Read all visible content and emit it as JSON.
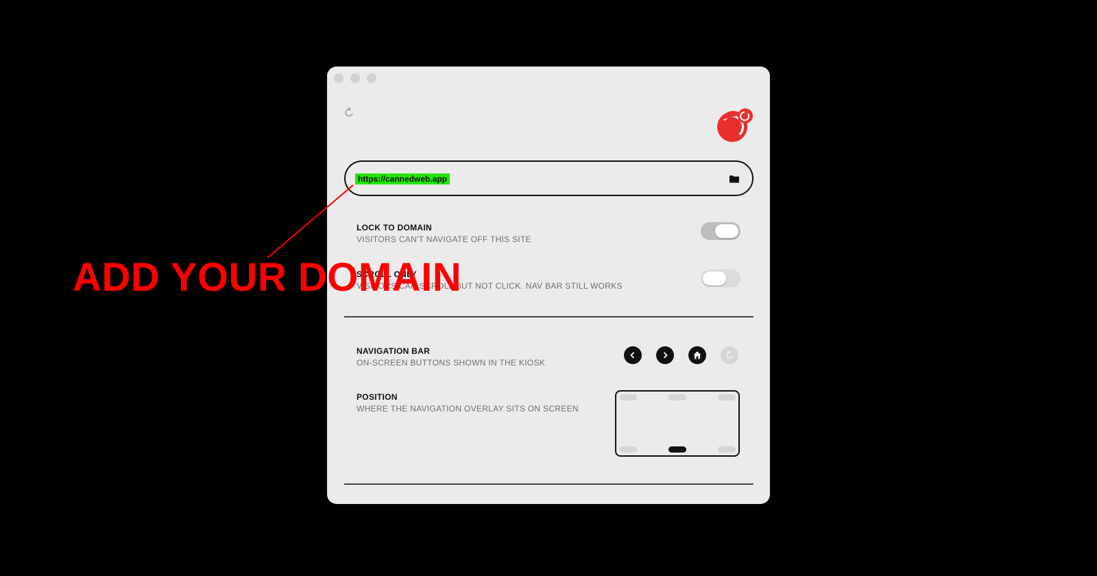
{
  "url_field": {
    "value": "https://cannedweb.app"
  },
  "settings": {
    "lock_to_domain": {
      "title": "LOCK TO DOMAIN",
      "subtitle": "VISITORS CAN'T NAVIGATE OFF THIS SITE",
      "enabled": true
    },
    "scroll_only": {
      "title": "SCROLL ONLY",
      "subtitle": "VISITORS CAN SCROLL BUT NOT CLICK. NAV BAR STILL WORKS",
      "enabled": false
    },
    "navigation_bar": {
      "title": "NAVIGATION BAR",
      "subtitle": "ON-SCREEN BUTTONS SHOWN IN THE KIOSK",
      "buttons": [
        "back-icon",
        "forward-icon",
        "home-icon",
        "reload-icon"
      ]
    },
    "position": {
      "title": "POSITION",
      "subtitle": "WHERE THE NAVIGATION OVERLAY SITS ON SCREEN",
      "selected": "bottom-center"
    }
  },
  "annotation": {
    "text": "ADD YOUR DOMAIN",
    "color": "#ff0000"
  },
  "colors": {
    "url_highlight": "#22e600",
    "logo": "#e8312f",
    "window": "#ebebeb"
  }
}
